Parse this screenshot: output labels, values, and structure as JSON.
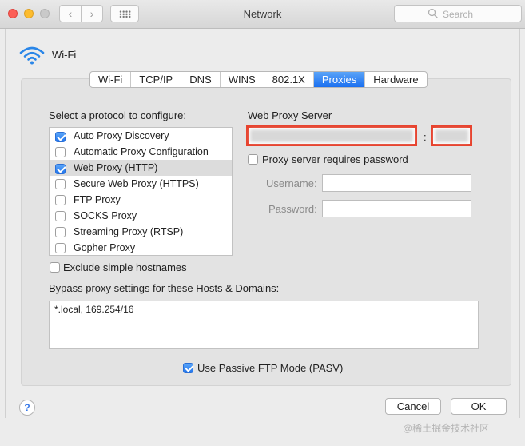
{
  "window": {
    "title": "Network",
    "search_placeholder": "Search",
    "nav_back": "‹",
    "nav_forward": "›"
  },
  "interface": {
    "name": "Wi-Fi"
  },
  "tabs": [
    {
      "label": "Wi-Fi",
      "active": false
    },
    {
      "label": "TCP/IP",
      "active": false
    },
    {
      "label": "DNS",
      "active": false
    },
    {
      "label": "WINS",
      "active": false
    },
    {
      "label": "802.1X",
      "active": false
    },
    {
      "label": "Proxies",
      "active": true
    },
    {
      "label": "Hardware",
      "active": false
    }
  ],
  "protocols": {
    "heading": "Select a protocol to configure:",
    "items": [
      {
        "label": "Auto Proxy Discovery",
        "checked": true,
        "selected": false
      },
      {
        "label": "Automatic Proxy Configuration",
        "checked": false,
        "selected": false
      },
      {
        "label": "Web Proxy (HTTP)",
        "checked": true,
        "selected": true
      },
      {
        "label": "Secure Web Proxy (HTTPS)",
        "checked": false,
        "selected": false
      },
      {
        "label": "FTP Proxy",
        "checked": false,
        "selected": false
      },
      {
        "label": "SOCKS Proxy",
        "checked": false,
        "selected": false
      },
      {
        "label": "Streaming Proxy (RTSP)",
        "checked": false,
        "selected": false
      },
      {
        "label": "Gopher Proxy",
        "checked": false,
        "selected": false
      }
    ]
  },
  "proxy_server": {
    "heading": "Web Proxy Server",
    "separator": ":",
    "requires_password_label": "Proxy server requires password",
    "requires_password": false,
    "username_label": "Username:",
    "password_label": "Password:"
  },
  "exclude_simple": {
    "label": "Exclude simple hostnames",
    "checked": false
  },
  "bypass": {
    "label": "Bypass proxy settings for these Hosts & Domains:",
    "value": "*.local, 169.254/16"
  },
  "passive_ftp": {
    "label": "Use Passive FTP Mode (PASV)",
    "checked": true
  },
  "buttons": {
    "help": "?",
    "cancel": "Cancel",
    "ok": "OK"
  },
  "watermark": "@稀土掘金技术社区",
  "colors": {
    "accent": "#1f74ee",
    "redaction_border": "#e8432e"
  }
}
